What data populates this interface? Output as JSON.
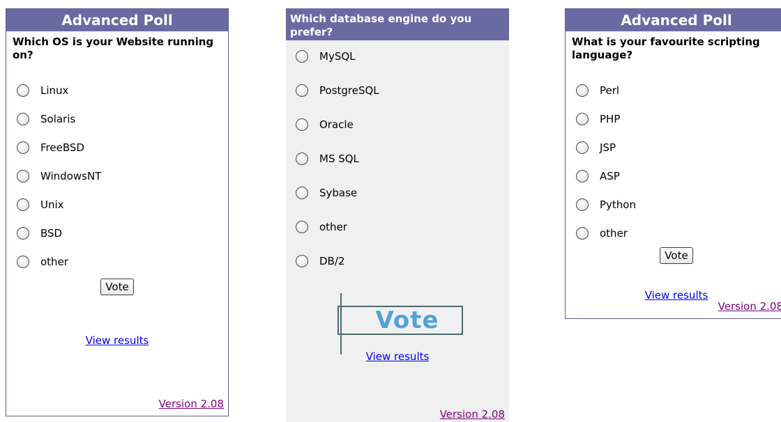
{
  "poll1": {
    "title": "Advanced Poll",
    "question": "Which OS is your Website running on?",
    "options": [
      "Linux",
      "Solaris",
      "FreeBSD",
      "WindowsNT",
      "Unix",
      "BSD",
      "other"
    ],
    "vote_label": "Vote",
    "results_label": "View results",
    "version": "Version 2.08"
  },
  "poll2": {
    "question": "Which database engine do you prefer?",
    "options": [
      "MySQL",
      "PostgreSQL",
      "Oracle",
      "MS SQL",
      "Sybase",
      "other",
      "DB/2"
    ],
    "vote_label": "Vote",
    "results_label": "View results",
    "version": "Version 2.08"
  },
  "poll3": {
    "title": "Advanced Poll",
    "question": "What is your favourite scripting language?",
    "options": [
      "Perl",
      "PHP",
      "JSP",
      "ASP",
      "Python",
      "other"
    ],
    "vote_label": "Vote",
    "results_label": "View results",
    "version": "Version 2.08"
  },
  "colors": {
    "header_bg": "#6a6aa3",
    "link": "#0000ee",
    "visited_link": "#800080",
    "vote_image_text": "#4fa3d8"
  }
}
